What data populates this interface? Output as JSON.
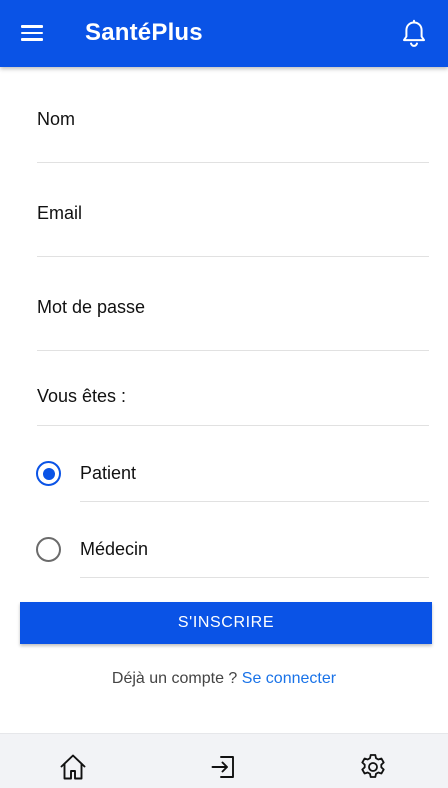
{
  "header": {
    "title": "SantéPlus",
    "menu_icon": "hamburger-menu-icon",
    "notification_icon": "bell-icon",
    "background_color": "#0a53e6"
  },
  "form": {
    "fields": {
      "name_label": "Nom",
      "email_label": "Email",
      "password_label": "Mot de passe"
    },
    "role": {
      "title": "Vous êtes :",
      "options": [
        {
          "label": "Patient",
          "selected": true
        },
        {
          "label": "Médecin",
          "selected": false
        }
      ]
    },
    "submit_label": "S'INSCRIRE"
  },
  "footer_prompt": {
    "text": "Déjà un compte ?",
    "link_label": "Se connecter",
    "link_color": "#1a73e8"
  },
  "bottom_nav": {
    "items": [
      {
        "icon": "home-icon"
      },
      {
        "icon": "login-icon"
      },
      {
        "icon": "settings-gear-icon"
      }
    ]
  }
}
